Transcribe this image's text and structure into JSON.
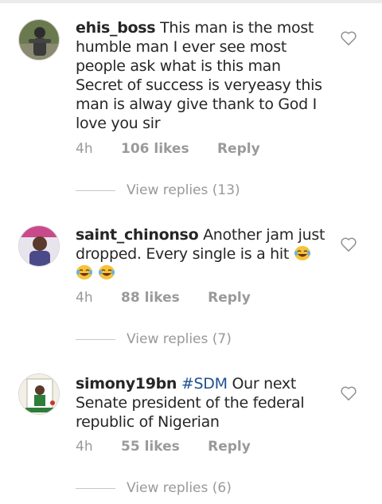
{
  "comments": [
    {
      "username": "ehis_boss",
      "hashtag": "",
      "text": "This man is the most humble man I ever see most people ask what is this man Secret of success is veryeasy this man is alway give thank to God I love you sir",
      "time": "4h",
      "likes": "106 likes",
      "reply": "Reply",
      "view_replies": "View replies (13)",
      "avatar_icon": "user-avatar-photo"
    },
    {
      "username": "saint_chinonso",
      "hashtag": "",
      "text": "Another jam just dropped. Every single is a hit",
      "emojis": [
        "😂",
        "😂",
        "😂"
      ],
      "time": "4h",
      "likes": "88 likes",
      "reply": "Reply",
      "view_replies": "View replies (7)",
      "avatar_icon": "user-avatar-photo"
    },
    {
      "username": "simony19bn",
      "hashtag": "#SDM",
      "text": "Our next Senate president of the federal republic of Nigerian",
      "time": "4h",
      "likes": "55 likes",
      "reply": "Reply",
      "view_replies": "View replies (6)",
      "avatar_icon": "user-avatar-photo"
    }
  ],
  "colors": {
    "text": "#262626",
    "muted": "#999999",
    "hashtag": "#1e5191",
    "divider": "#c7c7c7"
  }
}
